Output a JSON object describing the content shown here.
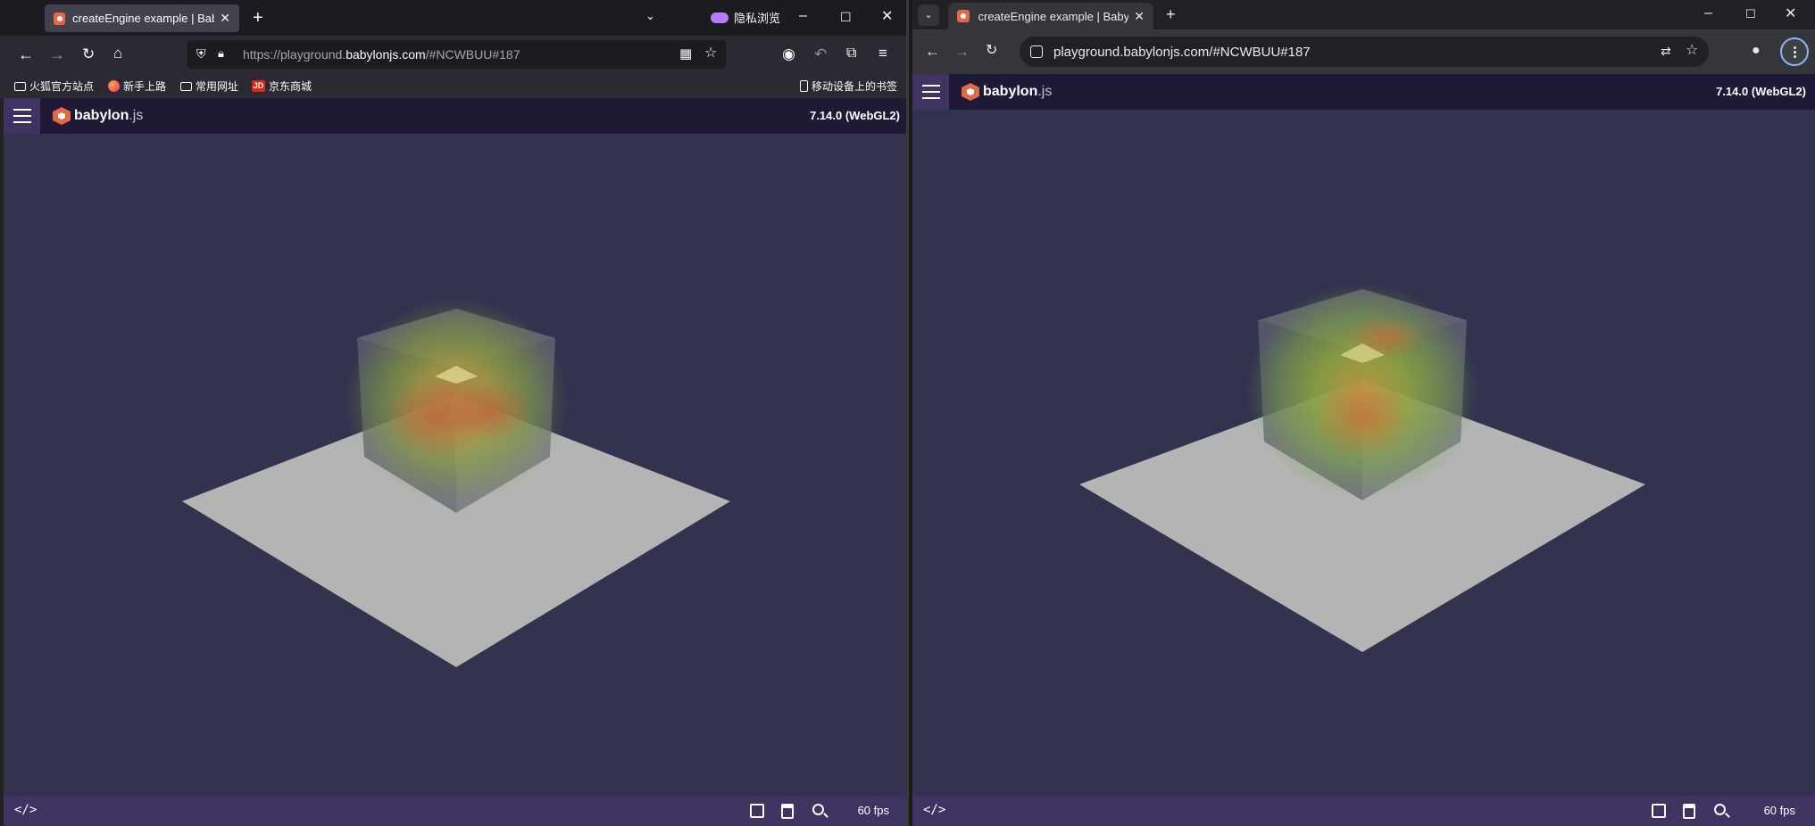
{
  "left_browser": {
    "tab_title": "createEngine example | Babylon",
    "private_label": "隐私浏览",
    "url_prefix": "https://playground.",
    "url_domain": "babylonjs.com",
    "url_suffix": "/#NCWBUU#187",
    "bookmarks": [
      {
        "label": "火狐官方站点",
        "icon": "folder-icon"
      },
      {
        "label": "新手上路",
        "icon": "firefox-icon"
      },
      {
        "label": "常用网址",
        "icon": "folder-icon"
      },
      {
        "label": "京东商城",
        "icon": "jd-icon"
      }
    ],
    "mobile_bookmarks": "移动设备上的书签",
    "jd_glyph": "JD"
  },
  "right_browser": {
    "tab_title": "createEngine example | Babylon",
    "url": "playground.babylonjs.com/#NCWBUU#187"
  },
  "playground": {
    "logo_main": "babylon",
    "logo_ext": ".js",
    "version": "7.14.0 (WebGL2)",
    "fps": "60 fps",
    "code_glyph": "</>"
  },
  "colors": {
    "header": "#201936",
    "footer": "#3f3461",
    "canvas": "#333350",
    "brand": "#e0684b"
  }
}
